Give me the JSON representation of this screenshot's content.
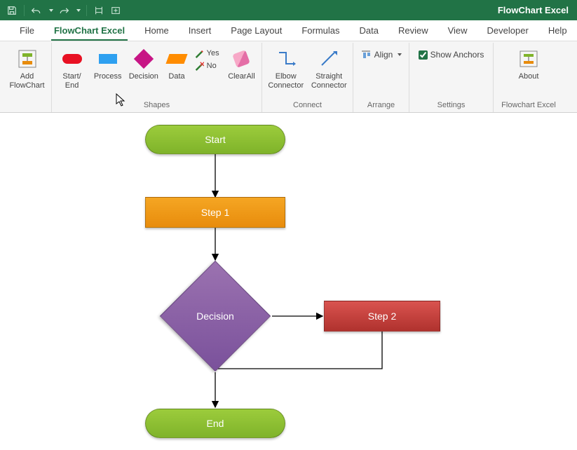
{
  "app": {
    "title": "FlowChart Excel"
  },
  "qat": {
    "save_icon": "save-icon",
    "undo_icon": "undo-icon",
    "redo_icon": "redo-icon",
    "touch_icon": "touch-icon",
    "autofit_icon": "autofit-icon"
  },
  "tabs": [
    {
      "label": "File"
    },
    {
      "label": "FlowChart Excel",
      "active": true
    },
    {
      "label": "Home"
    },
    {
      "label": "Insert"
    },
    {
      "label": "Page Layout"
    },
    {
      "label": "Formulas"
    },
    {
      "label": "Data"
    },
    {
      "label": "Review"
    },
    {
      "label": "View"
    },
    {
      "label": "Developer"
    },
    {
      "label": "Help"
    }
  ],
  "ribbon": {
    "groups": {
      "addflow": {
        "btn": "Add\nFlowChart"
      },
      "shapes": {
        "label": "Shapes",
        "startend": "Start/\nEnd",
        "process": "Process",
        "decision": "Decision",
        "data": "Data",
        "yes": "Yes",
        "no": "No",
        "clearall": "ClearAll"
      },
      "connect": {
        "label": "Connect",
        "elbow": "Elbow\nConnector",
        "straight": "Straight\nConnector"
      },
      "arrange": {
        "label": "Arrange",
        "align": "Align"
      },
      "settings": {
        "label": "Settings",
        "showanchors": "Show Anchors",
        "showanchors_checked": true
      },
      "about": {
        "label": "Flowchart Excel",
        "btn": "About"
      }
    }
  },
  "flowchart": {
    "start": "Start",
    "step1": "Step 1",
    "decision": "Decision",
    "step2": "Step 2",
    "end": "End"
  }
}
